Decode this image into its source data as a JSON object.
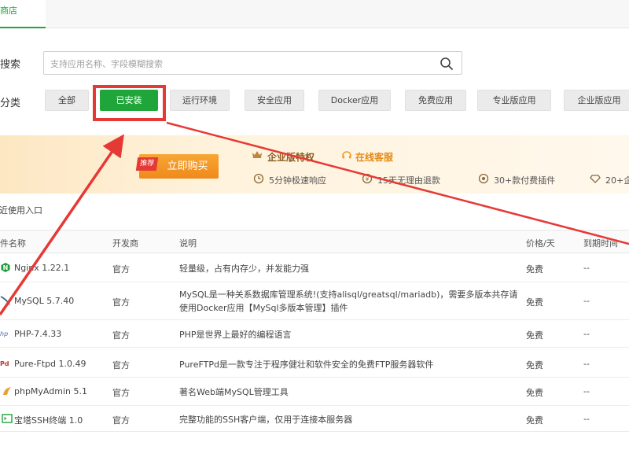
{
  "top_tab": {
    "label": "软件商店"
  },
  "search": {
    "label": "应用搜索",
    "placeholder": "支持应用名称、字段模糊搜索"
  },
  "category": {
    "label": "应用分类",
    "buttons": [
      "全部",
      "已安装",
      "运行环境",
      "安全应用",
      "Docker应用",
      "免费应用",
      "专业版应用",
      "企业版应用"
    ],
    "active": "已安装"
  },
  "banner": {
    "buy_label": "立即购买",
    "tag": "推荐",
    "enterprise_title": "企业版特权",
    "service_title": "在线客服",
    "features": [
      "5分钟极速响应",
      "15天无理由退款",
      "30+款付费插件",
      "20+企"
    ]
  },
  "recent": {
    "label": "最近使用入口"
  },
  "table": {
    "headers": [
      "软件名称",
      "开发商",
      "说明",
      "价格/天",
      "到期时间"
    ],
    "rows": [
      {
        "name": "Nginx 1.22.1",
        "vendor": "官方",
        "desc": "轻量级，占有内存少，并发能力强",
        "price": "免费",
        "expire": "--",
        "icon": "nginx-icon"
      },
      {
        "name": "MySQL 5.7.40",
        "vendor": "官方",
        "desc": "MySQL是一种关系数据库管理系统!(支持alisql/greatsql/mariadb)，需要多版本共存请使用Docker应用【MySql多版本管理】插件",
        "price": "免费",
        "expire": "--",
        "icon": "mysql-icon"
      },
      {
        "name": "PHP-7.4.33",
        "vendor": "官方",
        "desc": "PHP是世界上最好的编程语言",
        "price": "免费",
        "expire": "--",
        "icon": "php-icon"
      },
      {
        "name": "Pure-Ftpd 1.0.49",
        "vendor": "官方",
        "desc": "PureFTPd是一款专注于程序健壮和软件安全的免费FTP服务器软件",
        "price": "免费",
        "expire": "--",
        "icon": "ftp-icon"
      },
      {
        "name": "phpMyAdmin 5.1",
        "vendor": "官方",
        "desc": "著名Web端MySQL管理工具",
        "price": "免费",
        "expire": "--",
        "icon": "phpmyadmin-icon"
      },
      {
        "name": "宝塔SSH终端 1.0",
        "vendor": "官方",
        "desc": "完整功能的SSH客户端，仅用于连接本服务器",
        "price": "免费",
        "expire": "--",
        "icon": "ssh-terminal-icon"
      }
    ]
  },
  "colors": {
    "accent": "#20a53a",
    "annotation": "#e53935",
    "banner_button": "#f29a28"
  }
}
